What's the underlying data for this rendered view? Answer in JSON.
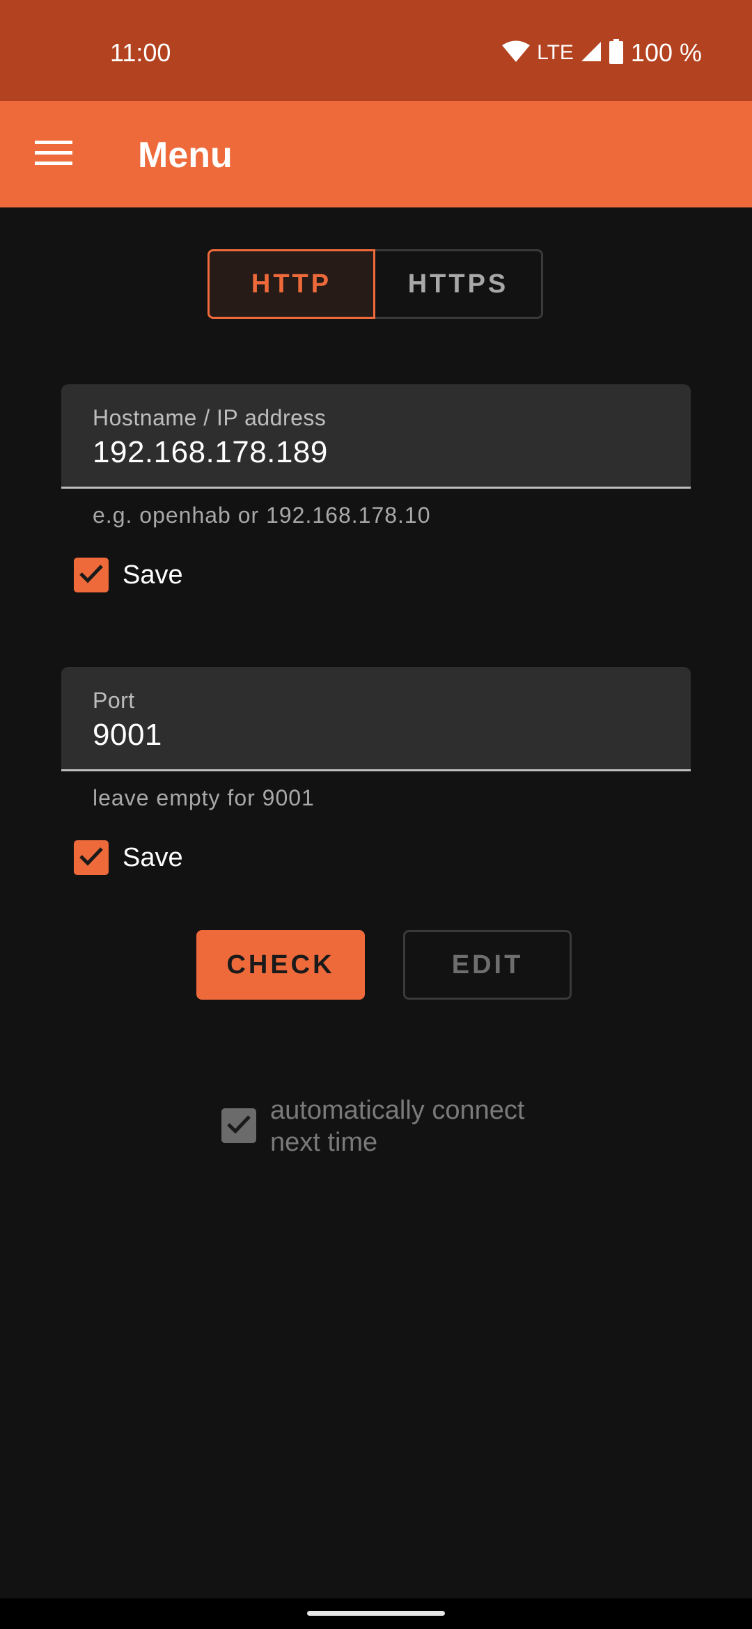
{
  "status_bar": {
    "time": "11:00",
    "network": "LTE",
    "battery": "100 %",
    "icons": [
      "wifi-icon",
      "signal-icon",
      "battery-icon"
    ]
  },
  "app_bar": {
    "title": "Menu",
    "menu_icon": "hamburger-menu-icon",
    "background_color": "#EE6A3B"
  },
  "protocol_toggle": {
    "options": [
      "HTTP",
      "HTTPS"
    ],
    "selected": "HTTP"
  },
  "hostname_field": {
    "label": "Hostname / IP address",
    "value": "192.168.178.189",
    "helper": "e.g. openhab or 192.168.178.10",
    "save_checkbox": {
      "label": "Save",
      "checked": true
    }
  },
  "port_field": {
    "label": "Port",
    "value": "9001",
    "helper": "leave empty for 9001",
    "save_checkbox": {
      "label": "Save",
      "checked": true
    }
  },
  "actions": {
    "check_label": "CHECK",
    "edit_label": "EDIT"
  },
  "auto_connect": {
    "label": "automatically connect next time",
    "checked": true,
    "enabled": false
  },
  "colors": {
    "accent": "#EE6A3B",
    "status_bar": "#B34320",
    "background": "#121212"
  }
}
